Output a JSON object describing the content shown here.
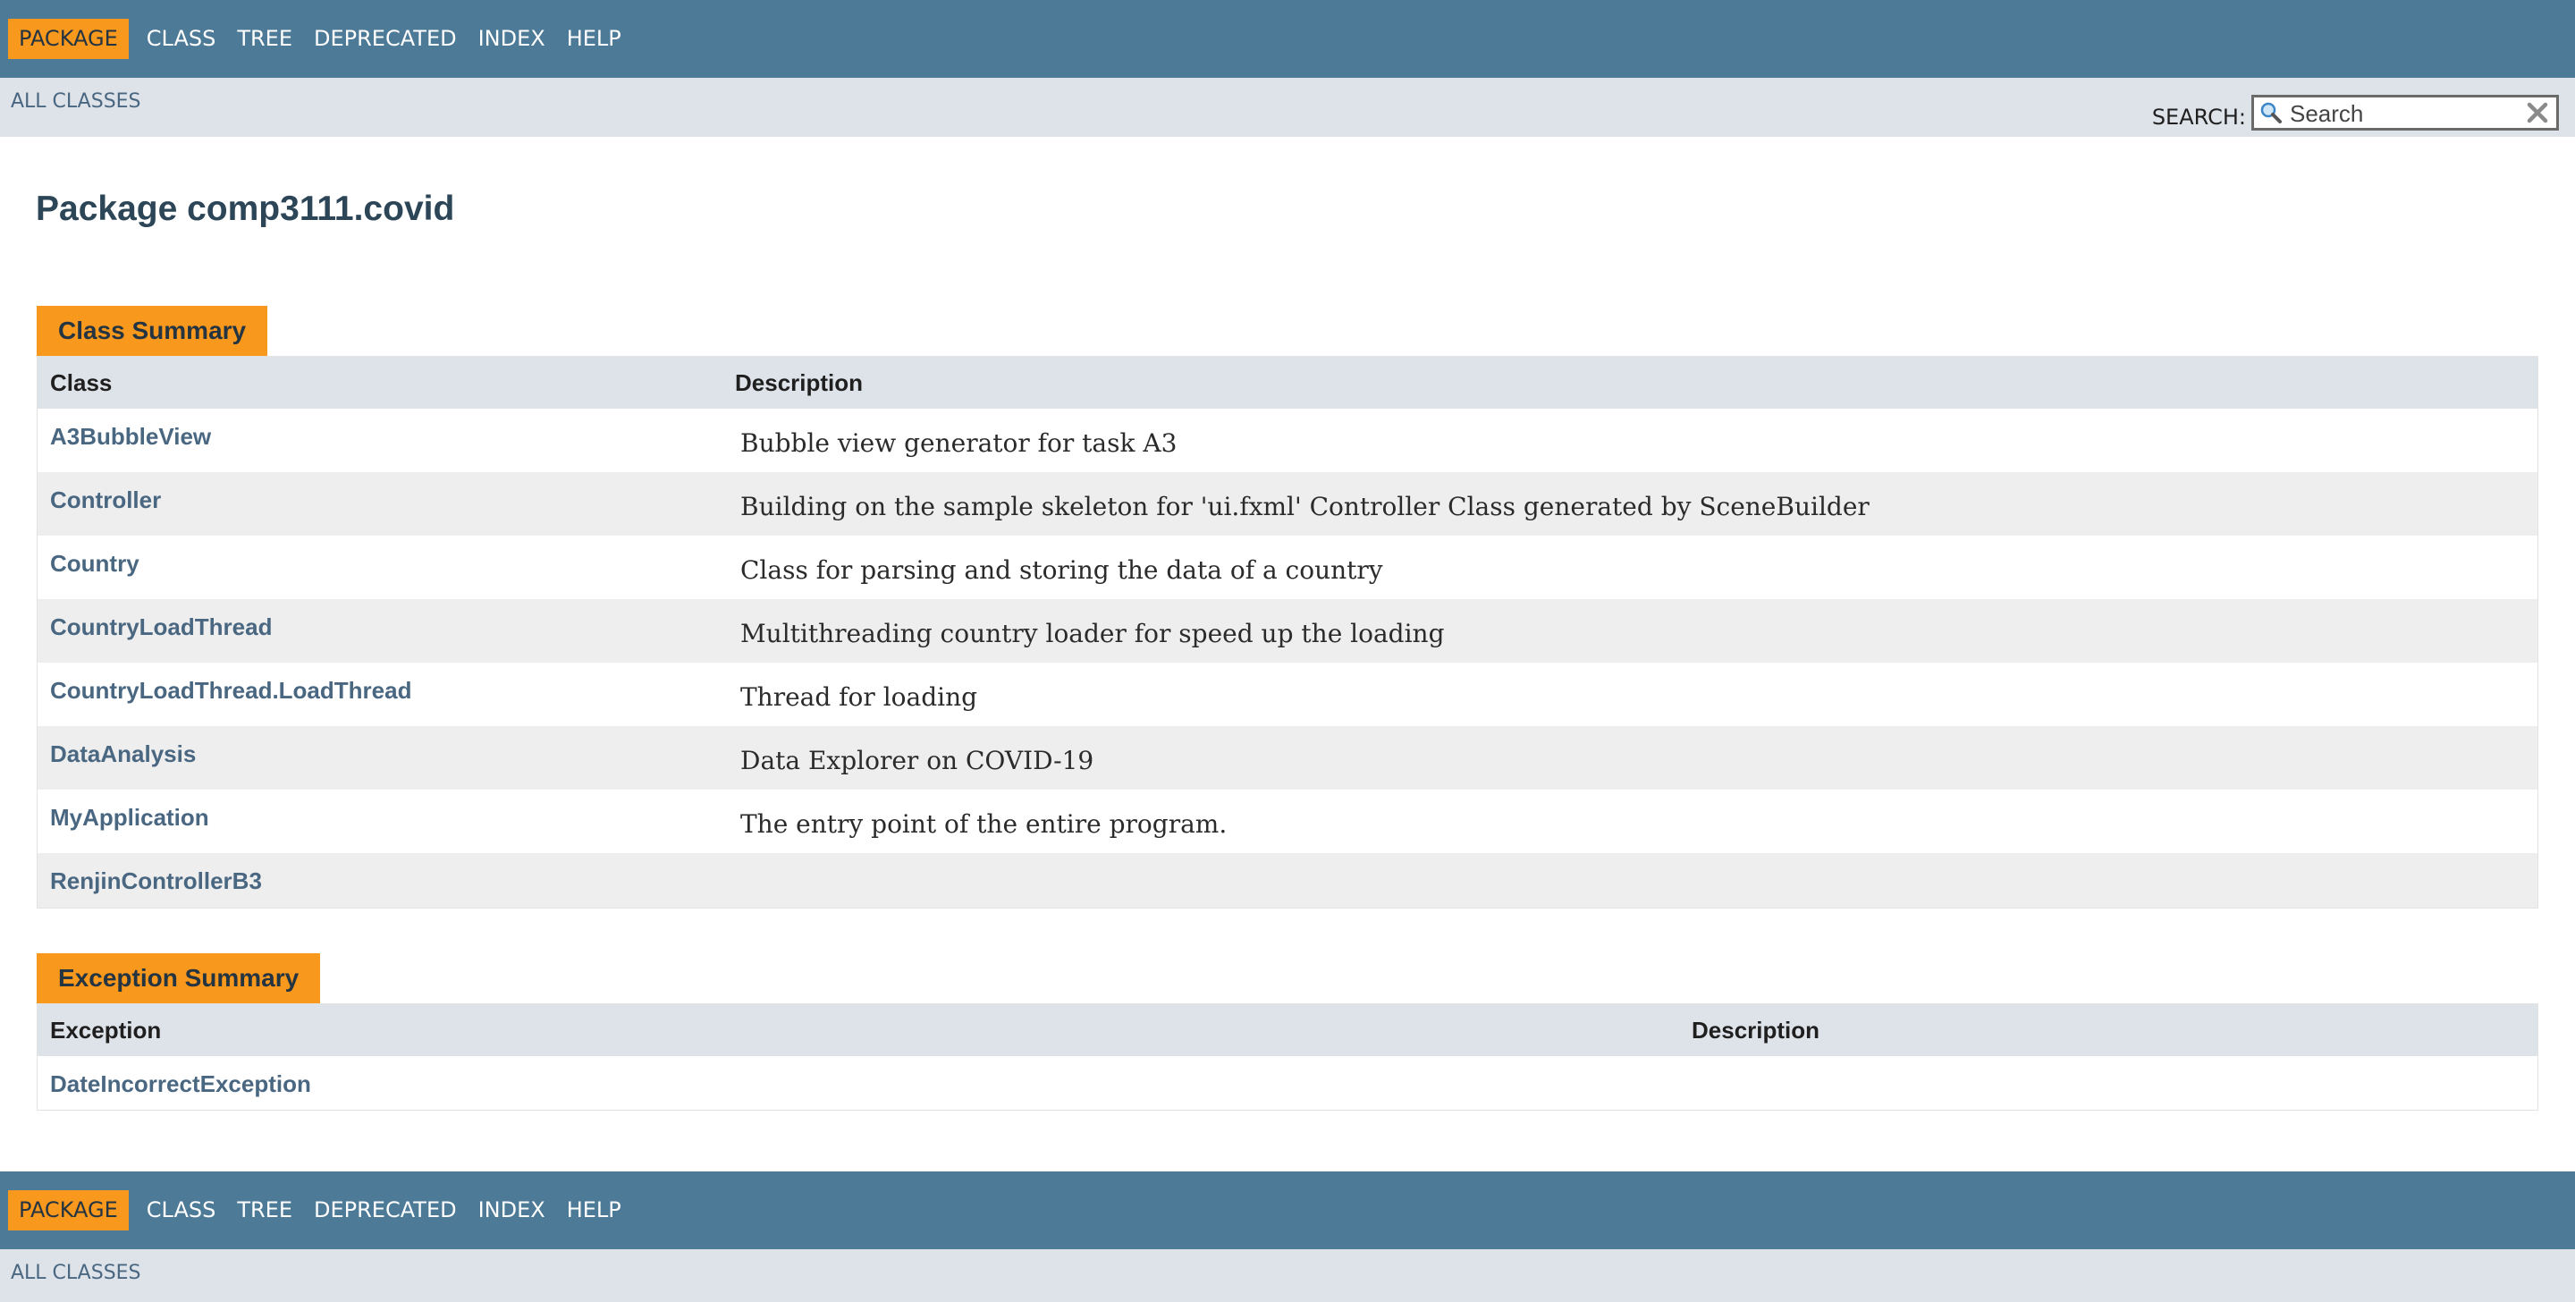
{
  "nav": {
    "items": [
      "PACKAGE",
      "CLASS",
      "TREE",
      "DEPRECATED",
      "INDEX",
      "HELP"
    ],
    "active": "PACKAGE"
  },
  "subnav": {
    "all_classes": "ALL CLASSES",
    "search_label": "SEARCH:",
    "search_placeholder": "Search"
  },
  "page_title": "Package comp3111.covid",
  "class_summary": {
    "caption": "Class Summary",
    "col_class": "Class",
    "col_description": "Description",
    "rows": [
      {
        "name": "A3BubbleView",
        "description": "Bubble view generator for task A3"
      },
      {
        "name": "Controller",
        "description": "Building on the sample skeleton for 'ui.fxml' Controller Class generated by SceneBuilder"
      },
      {
        "name": "Country",
        "description": "Class for parsing and storing the data of a country"
      },
      {
        "name": "CountryLoadThread",
        "description": "Multithreading country loader for speed up the loading"
      },
      {
        "name": "CountryLoadThread.LoadThread",
        "description": "Thread for loading"
      },
      {
        "name": "DataAnalysis",
        "description": "Data Explorer on COVID-19"
      },
      {
        "name": "MyApplication",
        "description": "The entry point of the entire program."
      },
      {
        "name": "RenjinControllerB3",
        "description": ""
      }
    ]
  },
  "exception_summary": {
    "caption": "Exception Summary",
    "col_exception": "Exception",
    "col_description": "Description",
    "rows": [
      {
        "name": "DateIncorrectException",
        "description": ""
      }
    ]
  },
  "colors": {
    "nav_bg": "#4d7a97",
    "active_bg": "#f8981d",
    "subnav_bg": "#dee3e9",
    "link": "#4a6782"
  },
  "icons": {
    "search": "magnifier-icon",
    "clear": "clear-x-icon"
  }
}
